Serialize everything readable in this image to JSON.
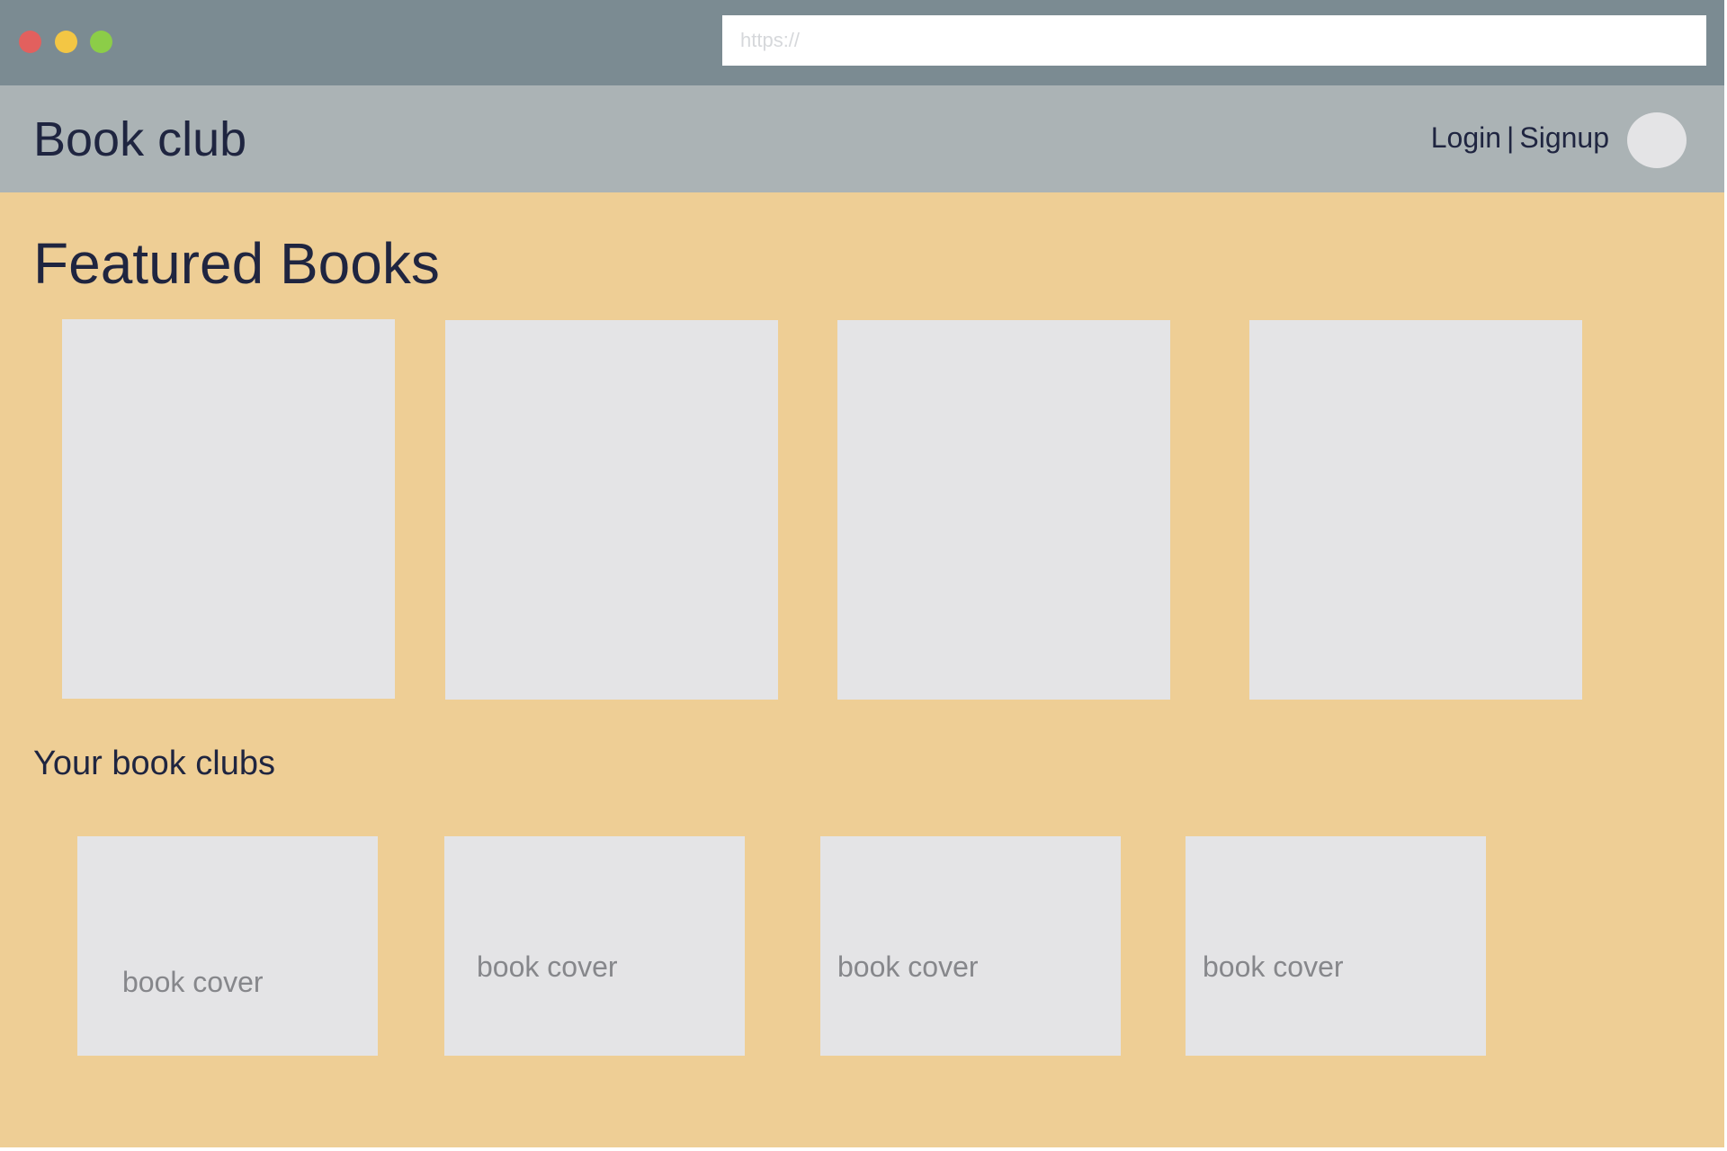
{
  "browser": {
    "url_placeholder": "https://",
    "url_value": ""
  },
  "header": {
    "logo": "Book club",
    "login_label": "Login",
    "separator": "|",
    "signup_label": "Signup"
  },
  "featured": {
    "title": "Featured Books",
    "books": [
      {
        "cover_label": ""
      },
      {
        "cover_label": ""
      },
      {
        "cover_label": ""
      },
      {
        "cover_label": ""
      }
    ]
  },
  "clubs": {
    "title": "Your book clubs",
    "items": [
      {
        "cover_label": "book cover"
      },
      {
        "cover_label": "book cover"
      },
      {
        "cover_label": "book cover"
      },
      {
        "cover_label": "book cover"
      }
    ]
  },
  "colors": {
    "titlebar": "#7b8b92",
    "header": "#abb3b5",
    "page_background": "#eece95",
    "placeholder": "#e4e4e6",
    "text": "#1f2540",
    "muted_text": "#86878b",
    "close": "#e2605e",
    "minimize": "#f3c644",
    "maximize": "#8ccd48"
  }
}
